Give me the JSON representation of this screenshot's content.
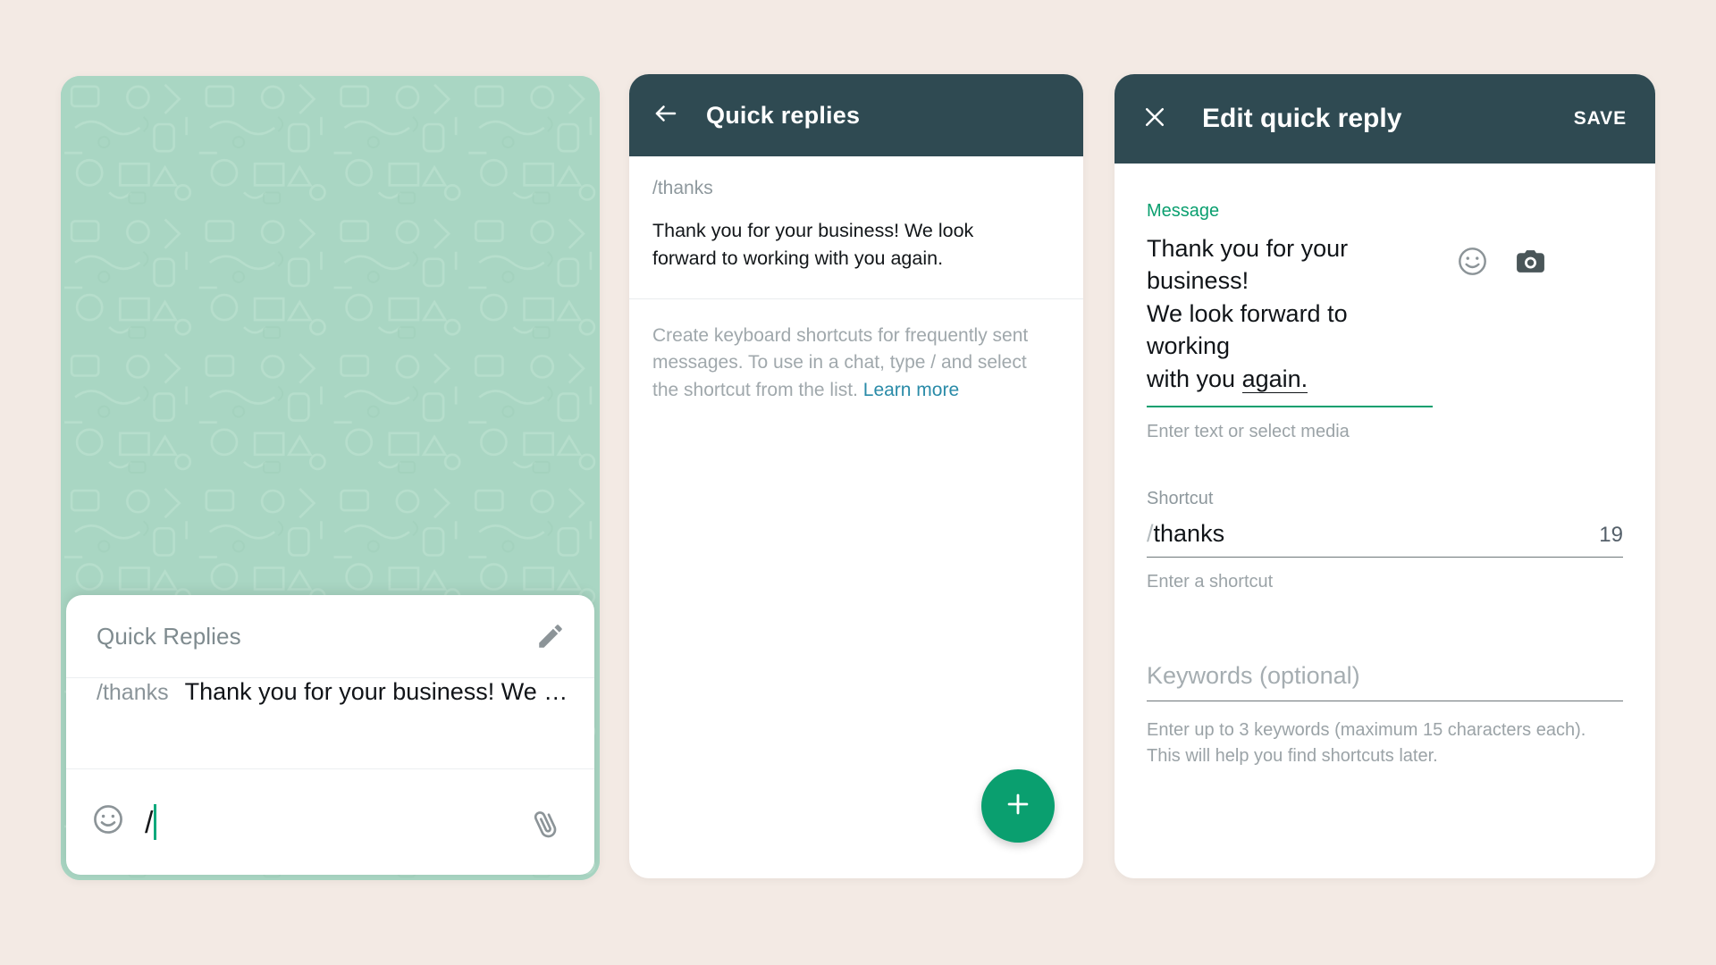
{
  "panel_chat": {
    "sheet": {
      "title": "Quick Replies",
      "edit_icon": "pencil-icon",
      "reply": {
        "shortcut": "/thanks",
        "message": "Thank you for your business! We …"
      }
    },
    "composer": {
      "emoji_icon": "emoji-smiley-icon",
      "typed_text": "/",
      "attach_icon": "paperclip-icon"
    },
    "wallpaper_color": "#a9d6c3"
  },
  "panel_list": {
    "appbar": {
      "back_icon": "back-arrow-icon",
      "title": "Quick replies"
    },
    "items": [
      {
        "shortcut": "/thanks",
        "message": "Thank you for your business! We look forward to working with you again."
      }
    ],
    "help": {
      "text": "Create keyboard shortcuts for frequently sent messages. To use in a chat, type / and select the shortcut from the list. ",
      "link_label": "Learn more",
      "link_color": "#2a8ba8"
    },
    "fab": {
      "icon": "plus-icon",
      "color": "#0a9f6f"
    }
  },
  "panel_edit": {
    "appbar": {
      "close_icon": "close-x-icon",
      "title": "Edit quick reply",
      "save_label": "SAVE"
    },
    "message_field": {
      "label": "Message",
      "value_line1": "Thank you for your business!",
      "value_line2": "We look forward to working",
      "value_line3_prefix": "with you ",
      "value_line3_misspelled": "again.",
      "helper": "Enter text or select media",
      "emoji_icon": "emoji-smiley-icon",
      "camera_icon": "camera-icon",
      "underline_color": "#0a9f6f",
      "label_color": "#0a9f6f"
    },
    "shortcut_field": {
      "label": "Shortcut",
      "slash": "/",
      "value": "thanks",
      "counter": "19",
      "helper": "Enter a shortcut"
    },
    "keywords_field": {
      "placeholder": "Keywords (optional)",
      "helper": "Enter up to 3 keywords (maximum 15 characters each). This will help you find shortcuts later."
    }
  }
}
